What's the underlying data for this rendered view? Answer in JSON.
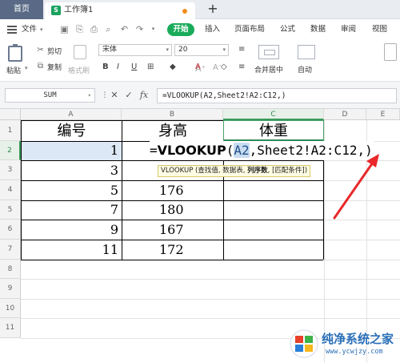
{
  "titlebar": {
    "home_tab": "首页",
    "doc_tab": "工作簿1",
    "doc_icon": "S",
    "add_tab": "+"
  },
  "menubar": {
    "file": "文件",
    "start": "开始",
    "items": [
      "插入",
      "页面布局",
      "公式",
      "数据",
      "审阅",
      "视图"
    ]
  },
  "ribbon": {
    "paste": "粘贴",
    "cut": "剪切",
    "copy": "复制",
    "format_painter": "格式刷",
    "font_name": "宋体",
    "font_size": "20",
    "merge_center": "合并居中",
    "auto_wrap": "自动"
  },
  "formula_bar": {
    "name_box": "SUM",
    "cancel": "✕",
    "confirm": "✓",
    "fx": "fx",
    "formula": "=VLOOKUP(A2,Sheet2!A2:C12,)"
  },
  "grid": {
    "columns": [
      "A",
      "B",
      "C",
      "D",
      "E"
    ],
    "rows": [
      "1",
      "2",
      "3",
      "4",
      "5",
      "6",
      "7",
      "8",
      "9",
      "10",
      "11"
    ],
    "header": {
      "a": "编号",
      "b": "身高",
      "c": "体重"
    },
    "data": [
      {
        "a": "1",
        "b": ""
      },
      {
        "a": "3",
        "b": ""
      },
      {
        "a": "5",
        "b": "176"
      },
      {
        "a": "7",
        "b": "180"
      },
      {
        "a": "9",
        "b": "167"
      },
      {
        "a": "11",
        "b": "172"
      }
    ],
    "in_cell_formula": {
      "eq": "=",
      "fname": "VLOOKUP",
      "open": "(",
      "ref": "A2",
      "rest": ",Sheet2!A2:C12,)"
    },
    "tooltip": {
      "pre": "VLOOKUP (查找值, 数据表, ",
      "bold": "列序数",
      "post": ", [匹配条件])"
    }
  },
  "watermark": {
    "text": "纯净系统之家",
    "url": "www.ycwjzy.com"
  },
  "colors": {
    "accent_green": "#1aab5a",
    "arrow_red": "#e8282a",
    "home_tab": "#5a6a86"
  }
}
